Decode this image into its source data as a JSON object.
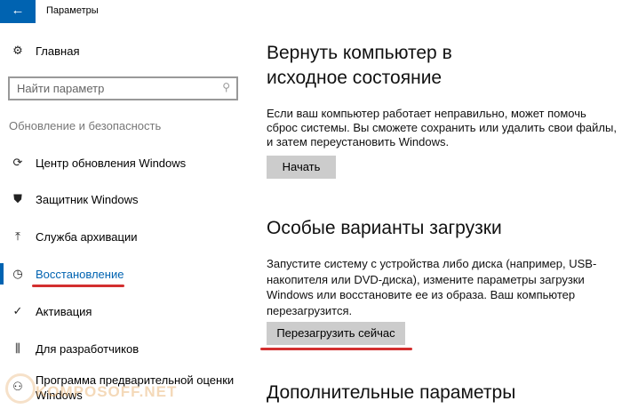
{
  "titlebar": {
    "back_icon": "arrow-left",
    "title": "Параметры"
  },
  "sidebar": {
    "home": "Главная",
    "search_placeholder": "Найти параметр",
    "section": "Обновление и безопасность",
    "items": [
      {
        "label": "Центр обновления Windows",
        "icon": "sync"
      },
      {
        "label": "Защитник Windows",
        "icon": "shield"
      },
      {
        "label": "Служба архивации",
        "icon": "upload-arrow"
      },
      {
        "label": "Восстановление",
        "icon": "history",
        "active": true
      },
      {
        "label": "Активация",
        "icon": "check-circle"
      },
      {
        "label": "Для разработчиков",
        "icon": "developer-tools"
      },
      {
        "label": "Программа предварительной оценки Windows",
        "icon": "insider"
      }
    ]
  },
  "main": {
    "reset": {
      "title": "Вернуть компьютер в исходное состояние",
      "text": "Если ваш компьютер работает неправильно, может помочь сброс системы. Вы сможете сохранить или удалить свои файлы, и затем переустановить Windows.",
      "button": "Начать"
    },
    "advanced_startup": {
      "title": "Особые варианты загрузки",
      "text": "Запустите систему с устройства либо диска (например, USB-накопителя или DVD-диска), измените параметры загрузки Windows или восстановите ее из образа. Ваш компьютер перезагрузится.",
      "button": "Перезагрузить сейчас"
    },
    "more": {
      "title": "Дополнительные параметры"
    }
  },
  "watermark": "KOMPOSOFF.NET",
  "colors": {
    "accent": "#0063b1",
    "highlight": "#d32f2f",
    "button": "#cccccc"
  }
}
